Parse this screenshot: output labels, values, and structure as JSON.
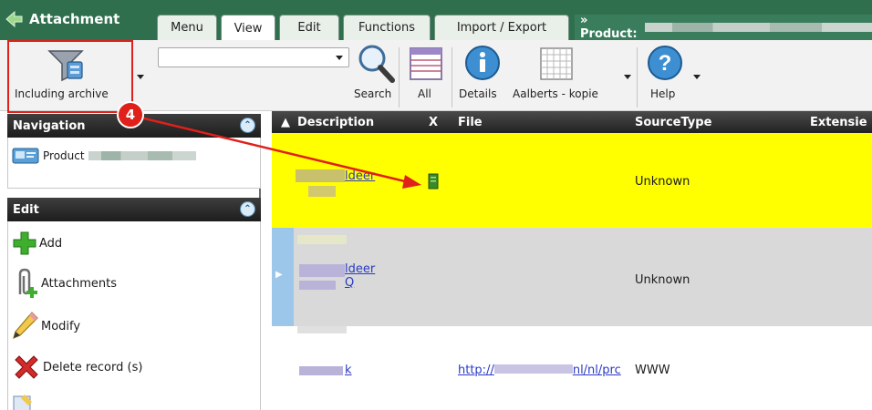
{
  "app": {
    "title": "Attachment"
  },
  "tabs": [
    {
      "label": "Menu"
    },
    {
      "label": "View"
    },
    {
      "label": "Edit"
    },
    {
      "label": "Functions"
    },
    {
      "label": "Import / Export"
    }
  ],
  "breadcrumb": {
    "prefix": "» Product:"
  },
  "ribbon": {
    "including_archive": "Including archive",
    "search": "Search",
    "all": "All",
    "details": "Details",
    "aalberts": "Aalberts - kopie",
    "help": "Help",
    "search_value": ""
  },
  "navigation": {
    "title": "Navigation",
    "item": "Product"
  },
  "edit_panel": {
    "title": "Edit",
    "items": [
      {
        "label": "Add",
        "icon": "plus-icon"
      },
      {
        "label": "Attachments",
        "icon": "paperclip-icon"
      },
      {
        "label": "Modify",
        "icon": "pencil-icon"
      },
      {
        "label": "Delete record (s)",
        "icon": "delete-x-icon"
      }
    ]
  },
  "grid": {
    "columns": [
      "Description",
      "X",
      "File",
      "SourceType",
      "Extensie"
    ],
    "rows": [
      {
        "description": "ldeer",
        "file": "",
        "source_type": "Unknown"
      },
      {
        "description": "ldeer",
        "description2": "Q",
        "file": "",
        "source_type": "Unknown"
      },
      {
        "description": "k",
        "file": "http://",
        "file_suffix": "nl/nl/prc",
        "source_type": "WWW"
      }
    ]
  },
  "annotation": {
    "step": "4"
  },
  "colors": {
    "topbar": "#2f6f4e",
    "highlight": "#e0201a",
    "selected_row": "#ffff00",
    "alt_row": "#d9d9d9"
  }
}
